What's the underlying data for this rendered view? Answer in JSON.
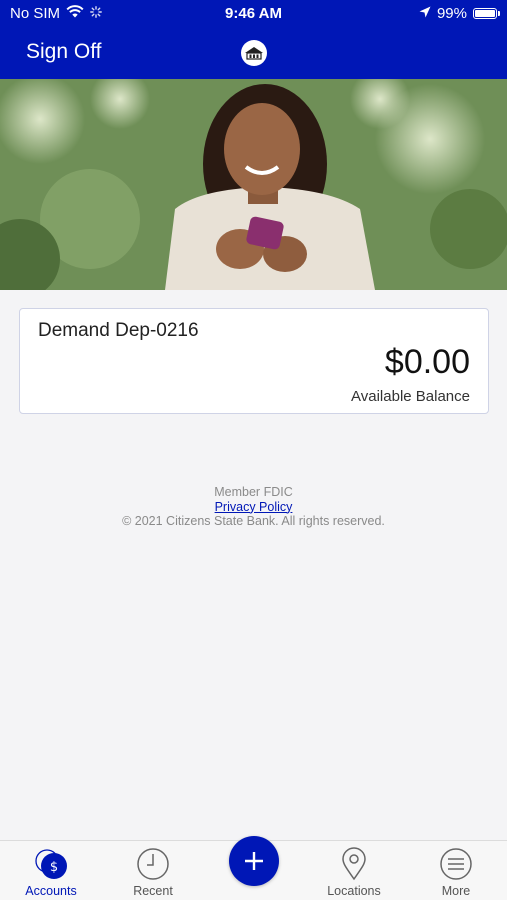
{
  "status_bar": {
    "carrier": "No SIM",
    "time": "9:46 AM",
    "battery": "99%"
  },
  "header": {
    "sign_off_label": "Sign Off",
    "logo_icon": "bank-logo-icon"
  },
  "account": {
    "name": "Demand Dep-0216",
    "balance": "$0.00",
    "balance_label": "Available Balance"
  },
  "footer": {
    "member": "Member FDIC",
    "privacy": "Privacy Policy",
    "copyright": "© 2021 Citizens State Bank. All rights reserved."
  },
  "tabs": [
    {
      "label": "Accounts",
      "icon": "accounts-icon",
      "active": true
    },
    {
      "label": "Recent",
      "icon": "clock-icon",
      "active": false
    },
    {
      "label": "Locations",
      "icon": "location-pin-icon",
      "active": false
    },
    {
      "label": "More",
      "icon": "menu-icon",
      "active": false
    }
  ],
  "colors": {
    "brand": "#0017b6",
    "background": "#f4f4f6"
  }
}
